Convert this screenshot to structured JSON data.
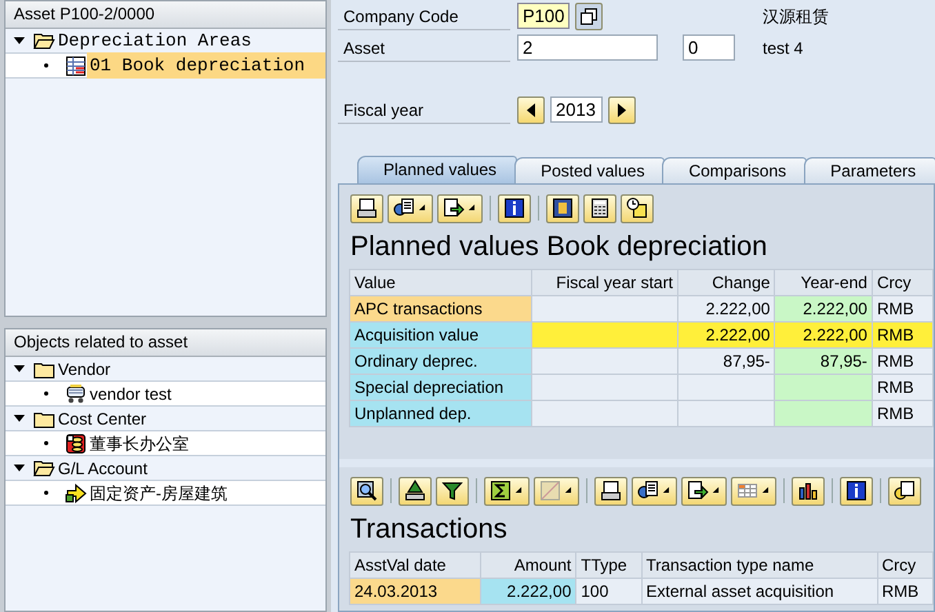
{
  "tree_top": {
    "header": "Asset P100-2/0000",
    "items": [
      {
        "label": "Depreciation Areas",
        "kind": "openfolder",
        "expanded": true,
        "children": [
          {
            "label": "01 Book depreciation",
            "kind": "area",
            "selected": true
          }
        ]
      }
    ]
  },
  "tree_bottom": {
    "header": "Objects related to asset",
    "items": [
      {
        "label": "Vendor",
        "kind": "folder",
        "expanded": true,
        "children": [
          {
            "label": "vendor test",
            "kind": "vendor",
            "selected": false
          }
        ]
      },
      {
        "label": "Cost Center",
        "kind": "folder",
        "expanded": true,
        "children": [
          {
            "label": "董事长办公室",
            "kind": "costcenter",
            "selected": false
          }
        ]
      },
      {
        "label": "G/L Account",
        "kind": "openfolder",
        "expanded": true,
        "children": [
          {
            "label": "固定资产-房屋建筑",
            "kind": "account",
            "selected": false
          }
        ]
      }
    ]
  },
  "form": {
    "company_code": {
      "label": "Company Code",
      "value": "P100",
      "description": "汉源租赁"
    },
    "asset": {
      "label": "Asset",
      "value": "2",
      "subnumber": "0",
      "description": "test 4"
    },
    "fiscal_year": {
      "label": "Fiscal year",
      "value": "2013"
    }
  },
  "tabs": [
    {
      "label": "Planned values",
      "selected": true
    },
    {
      "label": "Posted values",
      "selected": false
    },
    {
      "label": "Comparisons",
      "selected": false
    },
    {
      "label": "Parameters",
      "selected": false
    }
  ],
  "planned": {
    "title": "Planned values Book depreciation",
    "columns": [
      {
        "label": "Value",
        "kind": "label"
      },
      {
        "label": "Fiscal year start",
        "kind": "amount"
      },
      {
        "label": "Change",
        "kind": "amount"
      },
      {
        "label": "Year-end",
        "kind": "result"
      },
      {
        "label": "Crcy",
        "kind": "text"
      }
    ],
    "rows": [
      {
        "kind": "group",
        "cells": [
          "APC transactions",
          null,
          "2.222,00",
          "2.222,00",
          "RMB"
        ]
      },
      {
        "kind": "total",
        "cells": [
          "Acquisition value",
          null,
          "2.222,00",
          "2.222,00",
          "RMB"
        ]
      },
      {
        "kind": "item",
        "cells": [
          "Ordinary deprec.",
          null,
          "87,95-",
          "87,95-",
          "RMB"
        ]
      },
      {
        "kind": "item",
        "cells": [
          "Special depreciation",
          null,
          null,
          null,
          "RMB"
        ]
      },
      {
        "kind": "item",
        "cells": [
          "Unplanned dep.",
          null,
          null,
          null,
          "RMB"
        ]
      }
    ]
  },
  "transactions": {
    "title": "Transactions",
    "columns": [
      {
        "label": "AsstVal date",
        "kind": "key"
      },
      {
        "label": "Amount",
        "kind": "value"
      },
      {
        "label": "TType",
        "kind": "text"
      },
      {
        "label": "Transaction type name",
        "kind": "text"
      },
      {
        "label": "Crcy",
        "kind": "text"
      }
    ],
    "rows": [
      {
        "cells": [
          "24.03.2013",
          "2.222,00",
          "100",
          "External asset acquisition",
          "RMB"
        ]
      }
    ]
  }
}
